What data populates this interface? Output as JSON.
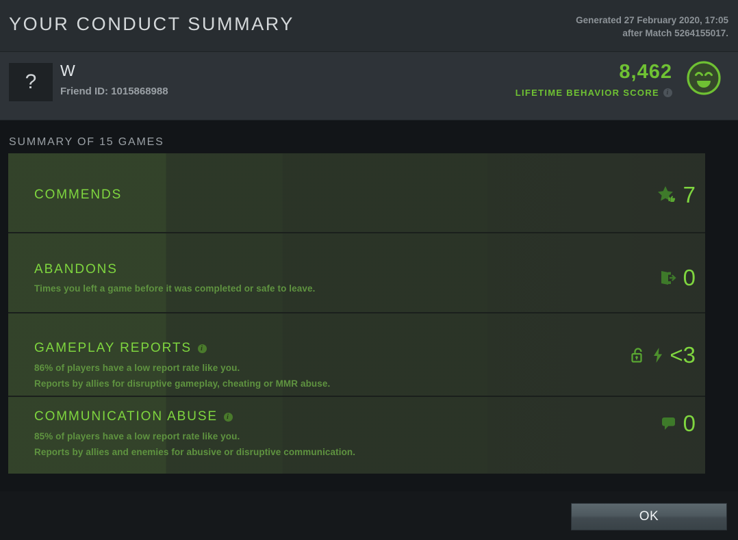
{
  "header": {
    "title": "YOUR CONDUCT SUMMARY",
    "generated_line1": "Generated 27 February 2020, 17:05",
    "generated_line2": "after Match 5264155017."
  },
  "profile": {
    "avatar_placeholder": "?",
    "player_name": "W",
    "friend_id": "Friend ID: 1015868988",
    "behavior_score": "8,462",
    "behavior_score_label": "LIFETIME BEHAVIOR SCORE",
    "info_icon": "info-icon",
    "mood_icon": "smiley-face-icon",
    "accent_green": "#7fd63f",
    "score_green": "#6fc133"
  },
  "summary": {
    "label": "SUMMARY OF 15 GAMES"
  },
  "rows": [
    {
      "name": "commends",
      "title": "COMMENDS",
      "has_info": false,
      "sub1": "",
      "sub2": "",
      "icons": [
        "commend-star-icon"
      ],
      "value": "7"
    },
    {
      "name": "abandons",
      "title": "ABANDONS",
      "has_info": false,
      "sub1": "Times you left a game before it was completed or safe to leave.",
      "sub2": "",
      "icons": [
        "exit-door-icon"
      ],
      "value": "0"
    },
    {
      "name": "gameplay-reports",
      "title": "GAMEPLAY REPORTS",
      "has_info": true,
      "sub1": "86% of players have a low report rate like you.",
      "sub2": "Reports by allies for disruptive gameplay, cheating or MMR abuse.",
      "icons": [
        "open-padlock-icon",
        "lightning-bolt-icon"
      ],
      "value": "<3"
    },
    {
      "name": "communication-abuse",
      "title": "COMMUNICATION ABUSE",
      "has_info": true,
      "sub1": "85% of players have a low report rate like you.",
      "sub2": "Reports by allies and enemies for abusive or disruptive communication.",
      "icons": [
        "speech-bubble-icon"
      ],
      "value": "0"
    }
  ],
  "footer": {
    "ok_label": "OK"
  }
}
